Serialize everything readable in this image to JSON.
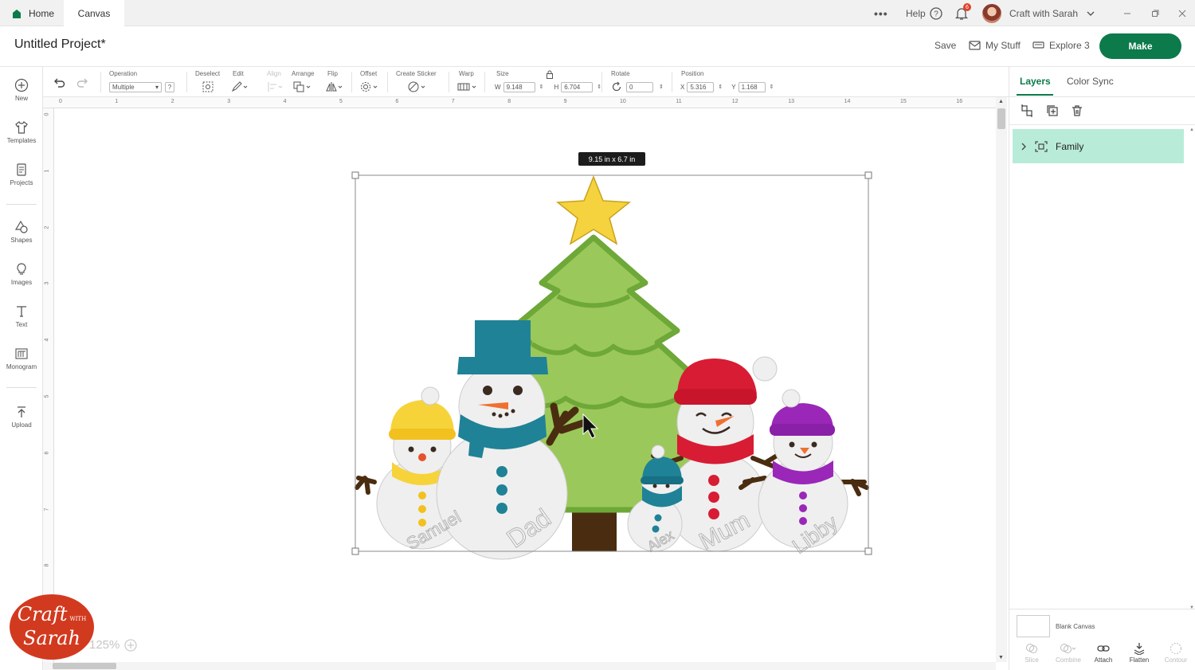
{
  "tabs": {
    "home": "Home",
    "canvas": "Canvas"
  },
  "topbar": {
    "more": "•••",
    "help": "Help",
    "notification_count": "6",
    "user_name": "Craft with Sarah"
  },
  "header": {
    "project_title": "Untitled Project*",
    "save": "Save",
    "my_stuff": "My Stuff",
    "machine": "Explore 3",
    "make": "Make"
  },
  "sidebar": {
    "new": "New",
    "templates": "Templates",
    "projects": "Projects",
    "shapes": "Shapes",
    "images": "Images",
    "text": "Text",
    "monogram": "Monogram",
    "upload": "Upload"
  },
  "toolbar": {
    "operation_label": "Operation",
    "operation_value": "Multiple",
    "deselect": "Deselect",
    "edit": "Edit",
    "align": "Align",
    "arrange": "Arrange",
    "flip": "Flip",
    "offset": "Offset",
    "create_sticker": "Create Sticker",
    "warp": "Warp",
    "size_label": "Size",
    "w_label": "W",
    "w_value": "9.148",
    "h_label": "H",
    "h_value": "6.704",
    "rotate_label": "Rotate",
    "rotate_value": "0",
    "position_label": "Position",
    "x_label": "X",
    "x_value": "5.316",
    "y_label": "Y",
    "y_value": "1.168"
  },
  "ruler": {
    "h": [
      "0",
      "1",
      "2",
      "3",
      "4",
      "5",
      "6",
      "7",
      "8",
      "9",
      "10",
      "11",
      "12",
      "13",
      "14",
      "15",
      "16"
    ],
    "v": [
      "0",
      "1",
      "2",
      "3",
      "4",
      "5",
      "6",
      "7",
      "8"
    ]
  },
  "canvas": {
    "size_tooltip": "9.15  in x 6.7  in",
    "names": [
      "Samuel",
      "Dad",
      "Alex",
      "Mum",
      "Libby"
    ],
    "zoom": "125%"
  },
  "right_panel": {
    "tab_layers": "Layers",
    "tab_color_sync": "Color Sync",
    "layer_name": "Family",
    "blank_canvas": "Blank Canvas",
    "slice": "Slice",
    "combine": "Combine",
    "attach": "Attach",
    "flatten": "Flatten",
    "contour": "Contour"
  },
  "logo": {
    "line1": "Craft",
    "with": "WITH",
    "line2": "Sarah"
  },
  "colors": {
    "accent_green": "#0c7a4a",
    "layer_highlight": "#b8ecd8",
    "tree": "#9bc85a",
    "tree_outline": "#6ea838",
    "star": "#f5d33f",
    "teal": "#1f8296",
    "red": "#d81c34",
    "purple": "#9a27b8",
    "yellow": "#f7d33a",
    "logo_red": "#d23a1f"
  }
}
